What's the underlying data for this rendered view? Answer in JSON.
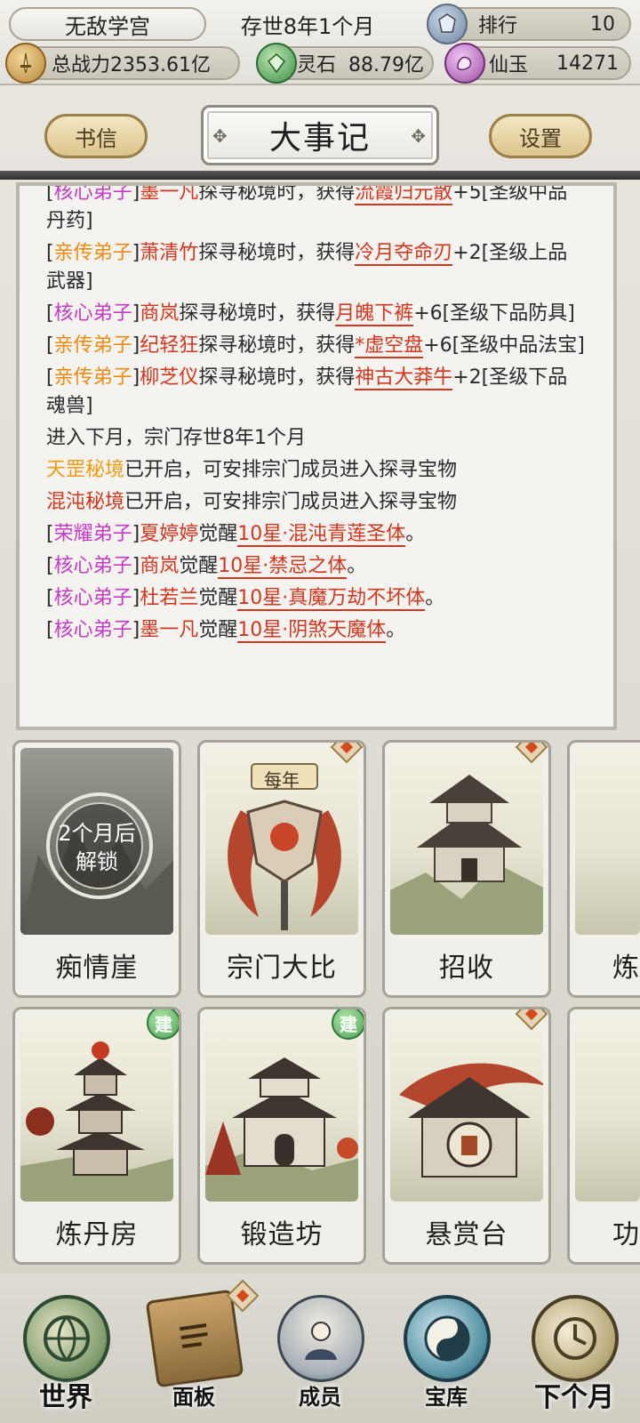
{
  "topbar": {
    "sect_name": "无敌学宫",
    "year_label": "存世8年1个月",
    "rank_label": "排行",
    "rank_value": "10",
    "power_label": "总战力2353.61亿",
    "stone_label": "灵石",
    "stone_value": "88.79亿",
    "jade_label": "仙玉",
    "jade_value": "14271"
  },
  "header": {
    "letters_button": "书信",
    "title": "大事记",
    "settings_button": "设置"
  },
  "log": {
    "lines": [
      {
        "tag": "核心弟子",
        "name": "墨一凡",
        "mid": "探寻秘境时，获得",
        "item": "流霞归元散",
        "rest": "+5[圣级中品丹药]"
      },
      {
        "tag": "亲传弟子",
        "name": "萧清竹",
        "mid": "探寻秘境时，获得",
        "item": "冷月夺命刃",
        "rest": "+2[圣级上品武器]"
      },
      {
        "tag": "核心弟子",
        "name": "商岚",
        "mid": "探寻秘境时，获得",
        "item": "月魄下裤",
        "rest": "+6[圣级下品防具]"
      },
      {
        "tag": "亲传弟子",
        "name": "纪轻狂",
        "mid": "探寻秘境时，获得",
        "item": "*虚空盘",
        "rest": "+6[圣级中品法宝]"
      },
      {
        "tag": "亲传弟子",
        "name": "柳芝仪",
        "mid": "探寻秘境时，获得",
        "item": "神古大莽牛",
        "rest": "+2[圣级下品魂兽]"
      }
    ],
    "month_line": "进入下月，宗门存世8年1个月",
    "realm1_name": "天罡秘境",
    "realm2_name": "混沌秘境",
    "realm_msg": "已开启，可安排宗门成员进入探寻宝物",
    "awaken": [
      {
        "tag": "荣耀弟子",
        "name": "夏婷婷",
        "verb": "觉醒",
        "trait": "10星·混沌青莲圣体",
        "end": "。"
      },
      {
        "tag": "核心弟子",
        "name": "商岚",
        "verb": "觉醒",
        "trait": "10星·禁忌之体",
        "end": "。"
      },
      {
        "tag": "核心弟子",
        "name": "杜若兰",
        "verb": "觉醒",
        "trait": "10星·真魔万劫不坏体",
        "end": "。"
      },
      {
        "tag": "核心弟子",
        "name": "墨一凡",
        "verb": "觉醒",
        "trait": "10星·阴煞天魔体",
        "end": "。"
      }
    ]
  },
  "buildings": {
    "row1": [
      {
        "label": "痴情崖",
        "lock_line1": "2个月后",
        "lock_line2": "解锁"
      },
      {
        "label": "宗门大比",
        "banner": "每年"
      },
      {
        "label": "招收"
      },
      {
        "label": "炼"
      }
    ],
    "row2": [
      {
        "label": "炼丹房",
        "badge": "建"
      },
      {
        "label": "锻造坊",
        "badge": "建"
      },
      {
        "label": "悬赏台"
      },
      {
        "label": "功"
      }
    ]
  },
  "nav": {
    "world": "世界",
    "panel": "面板",
    "members": "成员",
    "treasury": "宝库",
    "next_month": "下个月"
  },
  "colors": {
    "core_disciple": "#c639c6",
    "direct_disciple": "#ee8a12",
    "highlight_red": "#d1361e",
    "realm_orange": "#ee9a12"
  }
}
